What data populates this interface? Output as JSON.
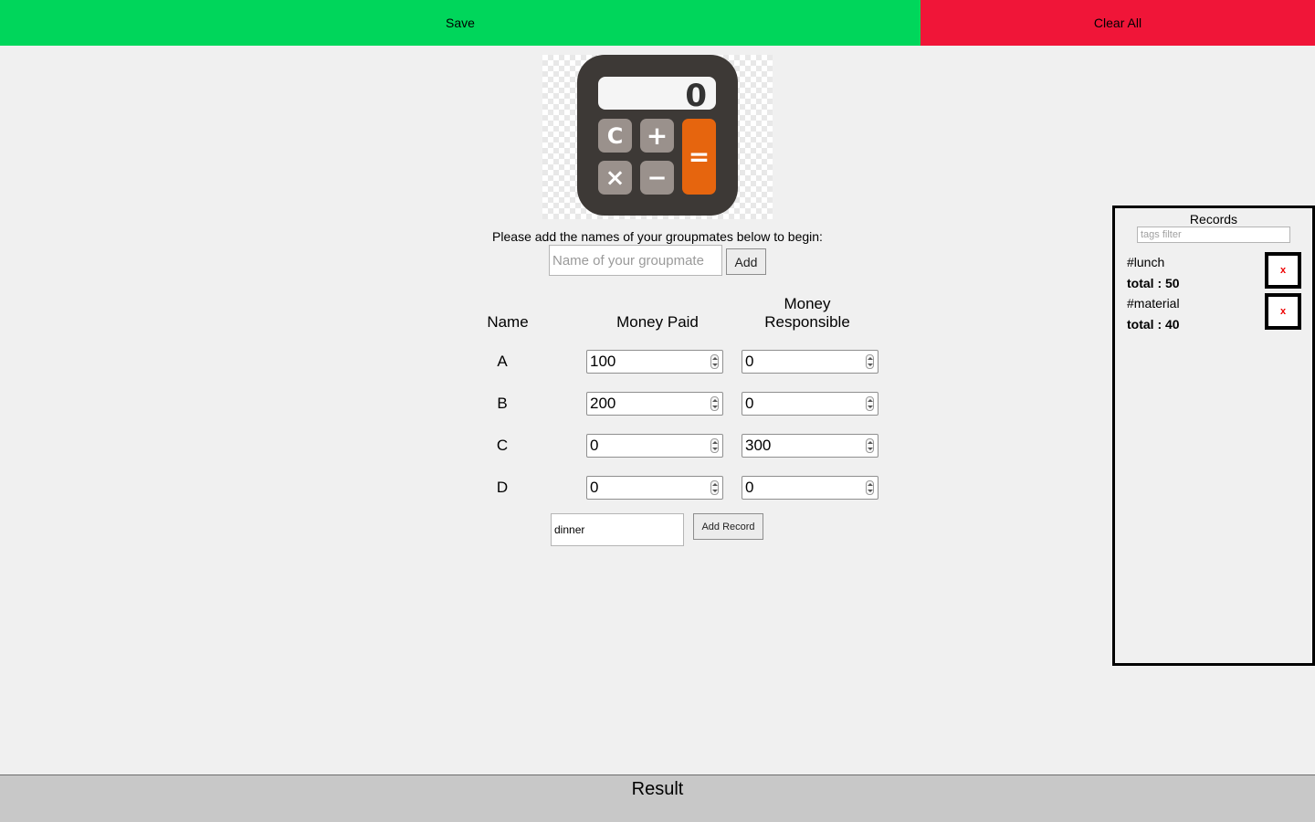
{
  "toolbar": {
    "save_label": "Save",
    "clear_label": "Clear All",
    "save_color": "#00d65b",
    "clear_color": "#f01538"
  },
  "logo": {
    "icon": "calculator-icon",
    "display_value": "0",
    "keys": [
      "C",
      "+",
      "×",
      "−",
      "="
    ]
  },
  "setup": {
    "instructions": "Please add the names of your groupmates below to begin:",
    "name_placeholder": "Name of your groupmate",
    "name_value": "",
    "add_label": "Add"
  },
  "table": {
    "headers": {
      "name": "Name",
      "paid": "Money Paid",
      "resp_line1": "Money",
      "resp_line2": "Responsible"
    },
    "rows": [
      {
        "name": "A",
        "paid": "100",
        "responsible": "0"
      },
      {
        "name": "B",
        "paid": "200",
        "responsible": "0"
      },
      {
        "name": "C",
        "paid": "0",
        "responsible": "300"
      },
      {
        "name": "D",
        "paid": "0",
        "responsible": "0"
      }
    ]
  },
  "record_form": {
    "tag_value": "dinner",
    "add_record_label": "Add Record"
  },
  "records": {
    "title": "Records",
    "filter_placeholder": "tags filter",
    "filter_value": "",
    "items": [
      {
        "tag": "#lunch",
        "total": "total : 50",
        "delete_label": "x"
      },
      {
        "tag": "#material",
        "total": "total : 40",
        "delete_label": "x"
      }
    ]
  },
  "result": {
    "title": "Result"
  }
}
